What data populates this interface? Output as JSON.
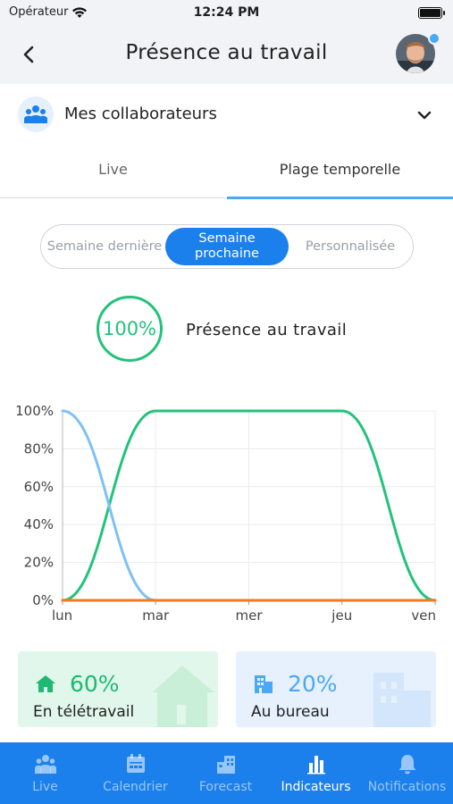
{
  "status_bar": {
    "carrier": "Opérateur",
    "time": "12:24 PM"
  },
  "header": {
    "title": "Présence au travail"
  },
  "team_selector": {
    "label": "Mes collaborateurs"
  },
  "tabs": [
    {
      "label": "Live",
      "active": false
    },
    {
      "label": "Plage temporelle",
      "active": true
    }
  ],
  "segments": [
    {
      "label": "Semaine dernière",
      "selected": false
    },
    {
      "label": "Semaine prochaine",
      "selected": true
    },
    {
      "label": "Personnalisée",
      "selected": false
    }
  ],
  "presence": {
    "percent": "100%",
    "label": "Présence au travail"
  },
  "chart_data": {
    "type": "line",
    "categories": [
      "lun",
      "mar",
      "mer",
      "jeu",
      "ven"
    ],
    "y_ticks": [
      "0%",
      "20%",
      "40%",
      "60%",
      "80%",
      "100%"
    ],
    "ylim": [
      0,
      100
    ],
    "grid": true,
    "series": [
      {
        "color": "#22c37a",
        "values": [
          0,
          100,
          100,
          100,
          0
        ]
      },
      {
        "color": "#7fc1f5",
        "values": [
          100,
          0,
          0,
          0,
          0
        ]
      },
      {
        "color": "#f27a24",
        "values": [
          0,
          0,
          0,
          0,
          0
        ]
      }
    ]
  },
  "cards": [
    {
      "percent": "60%",
      "label": "En télétravail",
      "color": "#1db872",
      "icon": "home-icon"
    },
    {
      "percent": "20%",
      "label": "Au bureau",
      "color": "#4aa9f5",
      "icon": "building-icon"
    }
  ],
  "bottom_nav": [
    {
      "label": "Live",
      "icon": "team-icon",
      "active": false
    },
    {
      "label": "Calendrier",
      "icon": "calendar-icon",
      "active": false
    },
    {
      "label": "Forecast",
      "icon": "forecast-icon",
      "active": false
    },
    {
      "label": "Indicateurs",
      "icon": "bar-chart-icon",
      "active": true
    },
    {
      "label": "Notifications",
      "icon": "bell-icon",
      "active": false
    }
  ],
  "colors": {
    "accent": "#1b80ec",
    "green": "#22c37a",
    "light_blue": "#4aa9f5",
    "orange": "#f27a24"
  }
}
